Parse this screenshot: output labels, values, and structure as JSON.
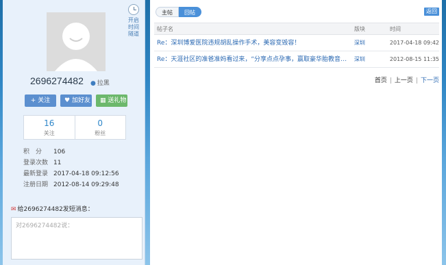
{
  "profile": {
    "username": "2696274482",
    "blacklist_label": "拉黑",
    "time_toggle": [
      "开启",
      "时间",
      "隧道"
    ],
    "buttons": {
      "follow": "+ 关注",
      "add_friend": "加好友",
      "send_gift": "送礼物"
    },
    "stats": [
      {
        "value": "16",
        "label": "关注"
      },
      {
        "value": "0",
        "label": "粉丝"
      }
    ],
    "info": [
      {
        "key": "积　分",
        "value": "106"
      },
      {
        "key": "登录次数",
        "value": "11"
      },
      {
        "key": "最新登录",
        "value": "2017-04-18 09:12:56"
      },
      {
        "key": "注册日期",
        "value": "2012-08-14 09:29:48"
      }
    ],
    "message": {
      "title": "给2696274482发短消息：",
      "placeholder": "对2696274482说："
    }
  },
  "main": {
    "tabs": [
      {
        "label": "主帖",
        "active": false
      },
      {
        "label": "回帖",
        "active": true
      }
    ],
    "back_label": "返回",
    "table": {
      "headers": [
        "帖子名",
        "版块",
        "时间"
      ],
      "rows": [
        {
          "title": "Re：深圳博爱医院违规胡乱操作手术，美容变毁容！",
          "board": "深圳",
          "time": "2017-04-18 09:42"
        },
        {
          "title": "Re：天涯社区的准爸准妈看过来，“分享点点孕事，赢取豪华胎教音乐机”",
          "board": "深圳",
          "time": "2012-08-15 11:35"
        }
      ]
    },
    "pager": {
      "first": "首页",
      "prev": "上一页",
      "next": "下一页"
    }
  },
  "colors": {
    "accent": "#4a90d9",
    "link": "#2c6ab3",
    "gift": "#6cb86c"
  }
}
